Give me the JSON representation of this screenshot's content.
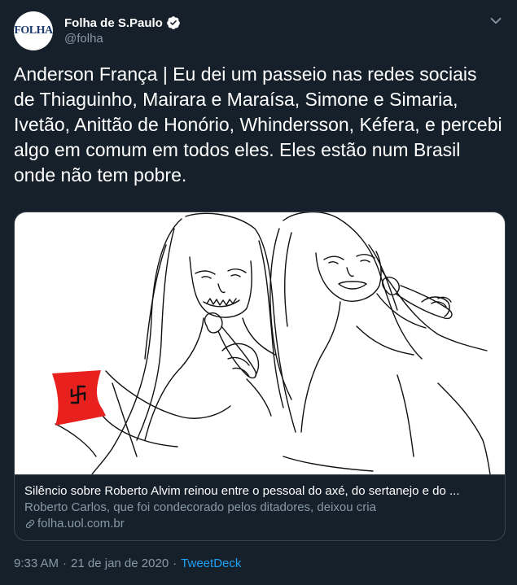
{
  "author": {
    "avatar_text": "FOLHA",
    "display_name": "Folha de S.Paulo",
    "handle": "@folha",
    "verified": true
  },
  "icons": {
    "verified": "verified-badge-icon",
    "more": "chevron-down-icon",
    "link": "link-icon"
  },
  "tweet": {
    "text": "Anderson França | Eu dei um passeio nas redes sociais de Thiaguinho, Mairara e Maraísa, Simone e Simaria, Ivetão, Anittão de Honório, Whindersson, Kéfera, e percebi algo em comum em todos eles. Eles estão num Brasil onde não tem pobre."
  },
  "card": {
    "title": "Silêncio sobre Roberto Alvim reinou entre o pessoal do axé, do sertanejo e do ...",
    "description": "Roberto Carlos, que foi condecorado pelos ditadores, deixou cria",
    "domain": "folha.uol.com.br"
  },
  "meta": {
    "time": "9:33 AM",
    "separator": "·",
    "date": "21 de jan de 2020",
    "source": "TweetDeck"
  },
  "colors": {
    "background": "#15202b",
    "secondary_text": "#8899a6",
    "accent": "#1da1f2",
    "border": "#38444d",
    "armband": "#e8201e"
  }
}
